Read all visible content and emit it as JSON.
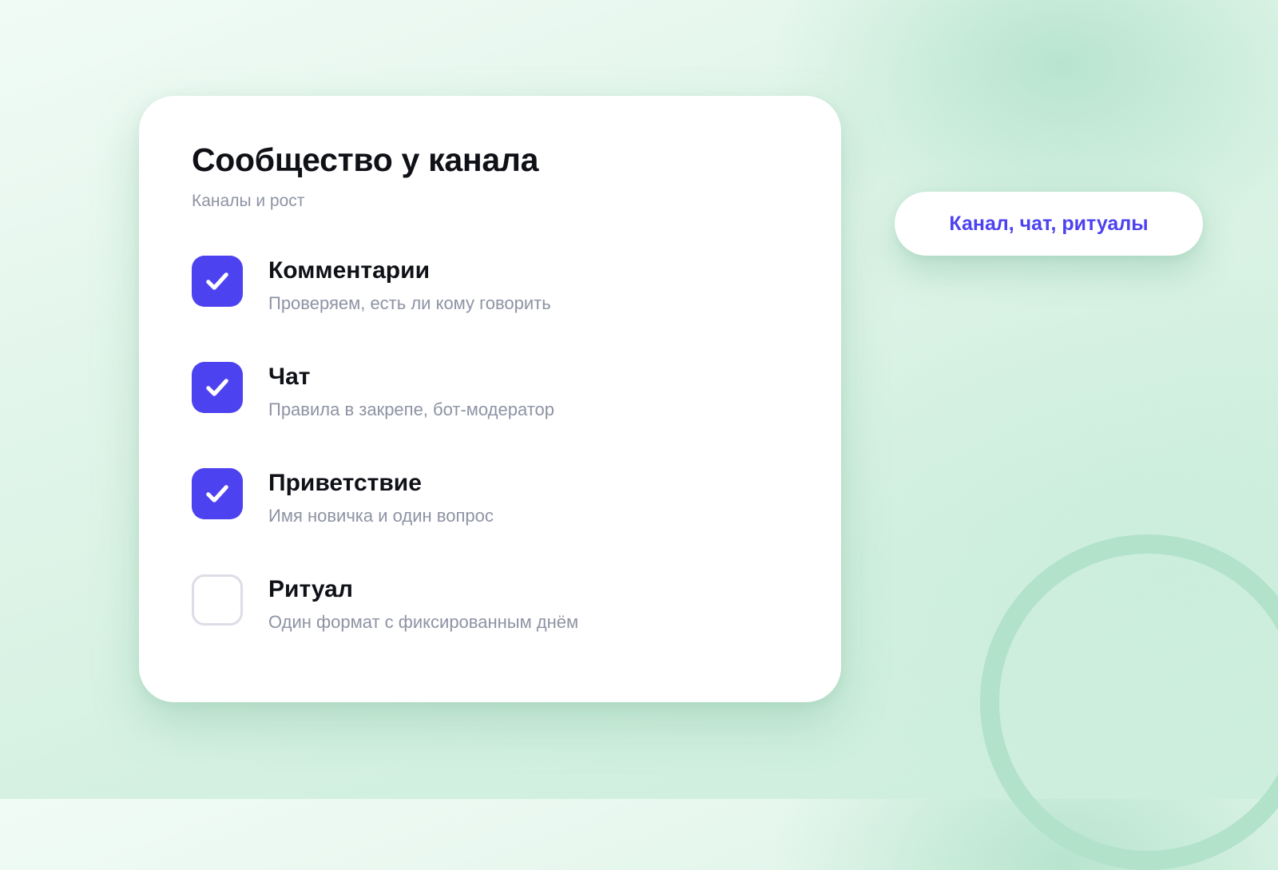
{
  "colors": {
    "accent": "#4d42ef",
    "background": "#d9f2e5",
    "card": "#ffffff",
    "title_text": "#0f1117",
    "muted_text": "#8e93a4",
    "ring": "#b2e2c9",
    "unchecked_border": "#dcdde6"
  },
  "card": {
    "title": "Сообщество у канала",
    "subtitle": "Каналы и рост",
    "items": [
      {
        "title": "Комментарии",
        "description": "Проверяем, есть ли кому говорить",
        "checked": true,
        "icon": "check-icon"
      },
      {
        "title": "Чат",
        "description": "Правила в закрепе, бот-модератор",
        "checked": true,
        "icon": "check-icon"
      },
      {
        "title": "Приветствие",
        "description": "Имя новичка и один вопрос",
        "checked": true,
        "icon": "check-icon"
      },
      {
        "title": "Ритуал",
        "description": "Один формат с фиксированным днём",
        "checked": false
      }
    ]
  },
  "pill": {
    "label": "Канал, чат, ритуалы"
  }
}
